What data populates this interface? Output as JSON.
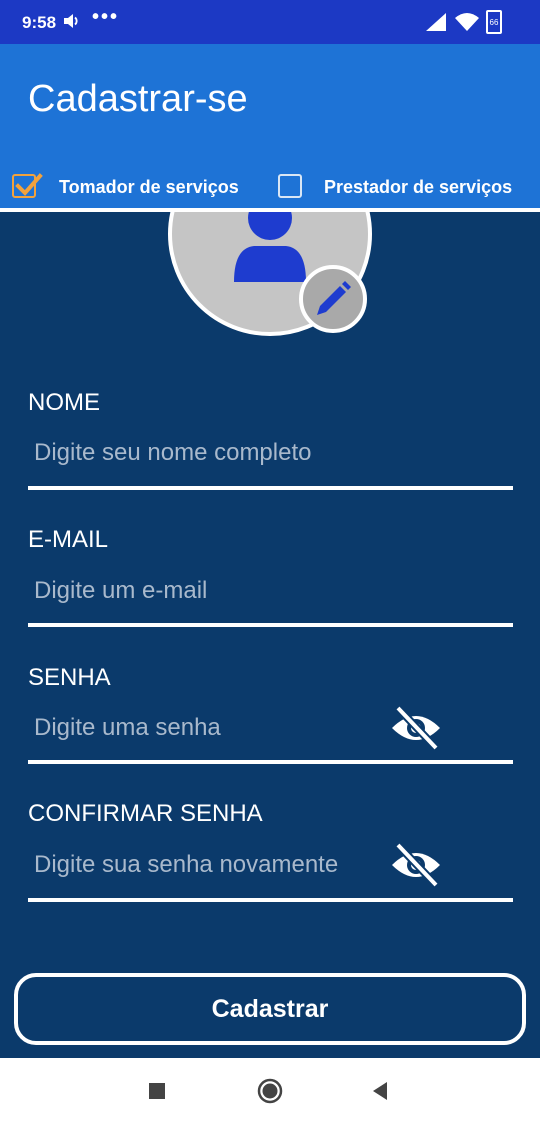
{
  "status_bar": {
    "time": "9:58",
    "dots": "•••",
    "battery_level": "66"
  },
  "app_bar": {
    "title": "Cadastrar-se",
    "options": [
      {
        "label": "Tomador de serviços",
        "checked": true
      },
      {
        "label": "Prestador de serviços",
        "checked": false
      }
    ]
  },
  "form": {
    "name": {
      "label": "NOME",
      "placeholder": "Digite seu nome completo",
      "value": ""
    },
    "email": {
      "label": "E-MAIL",
      "placeholder": "Digite um e-mail",
      "value": ""
    },
    "password": {
      "label": "SENHA",
      "placeholder": "Digite uma senha",
      "value": "",
      "icon": "eye-off-icon"
    },
    "confirm_password": {
      "label": "CONFIRMAR SENHA",
      "placeholder": "Digite sua senha novamente",
      "value": "",
      "icon": "eye-off-icon"
    },
    "submit_label": "Cadastrar"
  },
  "colors": {
    "status_bar": "#1c39c4",
    "app_bar": "#1e73d6",
    "background": "#0b3a6b",
    "checkbox_accent": "#f2a23d",
    "avatar_icon": "#1e3ccf"
  }
}
